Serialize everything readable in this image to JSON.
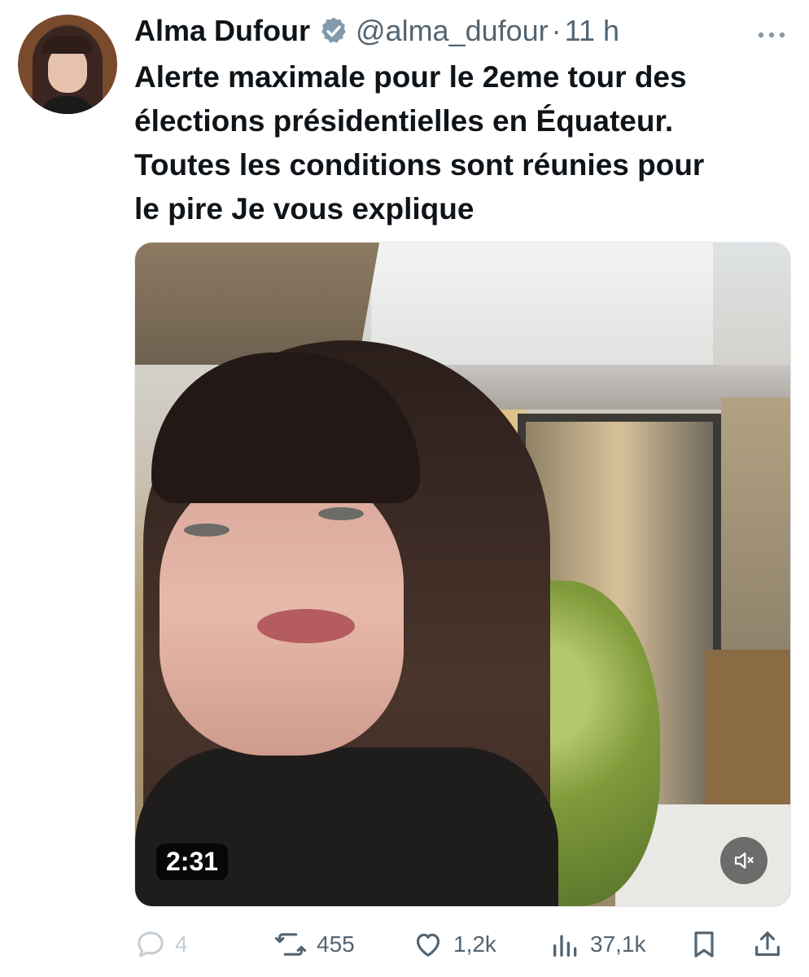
{
  "tweet": {
    "author_name": "Alma Dufour",
    "handle": "@alma_dufour",
    "separator": "·",
    "time": "11 h",
    "text_lines": [
      "Alerte maximale pour le 2eme tour des",
      "élections présidentielles en Équateur.",
      "Toutes les conditions sont réunies pour",
      "le pire Je vous explique"
    ]
  },
  "video": {
    "duration": "2:31",
    "muted": true
  },
  "actions": {
    "replies": "4",
    "reposts": "455",
    "likes": "1,2k",
    "views": "37,1k"
  },
  "colors": {
    "text": "#0f1419",
    "secondary": "#536471",
    "verified": "#829aab"
  },
  "icons": [
    "verified-badge-icon",
    "more-icon",
    "mute-icon",
    "reply-icon",
    "repost-icon",
    "like-icon",
    "views-icon",
    "bookmark-icon",
    "share-icon"
  ]
}
